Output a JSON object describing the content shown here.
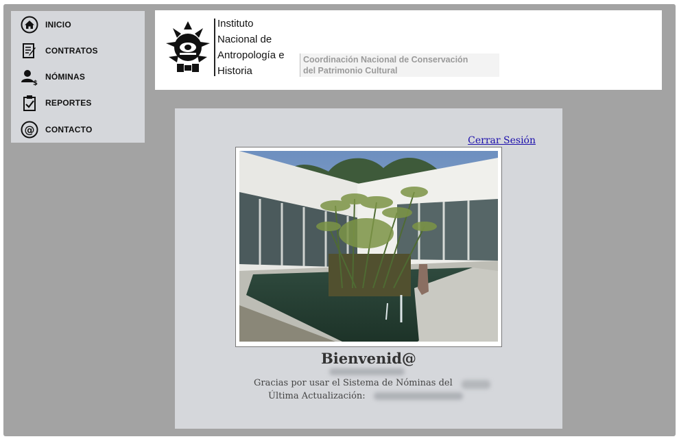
{
  "nav": {
    "items": [
      {
        "label": "INICIO",
        "icon": "home-icon"
      },
      {
        "label": "CONTRATOS",
        "icon": "contract-icon"
      },
      {
        "label": "NÓMINAS",
        "icon": "payroll-icon"
      },
      {
        "label": "REPORTES",
        "icon": "clipboard-check-icon"
      },
      {
        "label": "CONTACTO",
        "icon": "at-sign-icon"
      }
    ]
  },
  "header": {
    "institute_name": "Instituto Nacional de Antropología e Historia",
    "institute_lines": [
      "Instituto",
      "Nacional de",
      "Antropología e",
      "Historia"
    ],
    "coordination_lines": [
      "Coordinación Nacional de Conservación",
      "del Patrimonio Cultural"
    ]
  },
  "main": {
    "logout_label": "Cerrar Sesión",
    "welcome": "Bienvenid@",
    "thanks_text": "Gracias por usar el Sistema de Nóminas del",
    "last_update_label": "Última Actualización:"
  },
  "colors": {
    "background": "#a3a3a3",
    "panel": "#d5d7db",
    "link": "#1a0dab"
  }
}
